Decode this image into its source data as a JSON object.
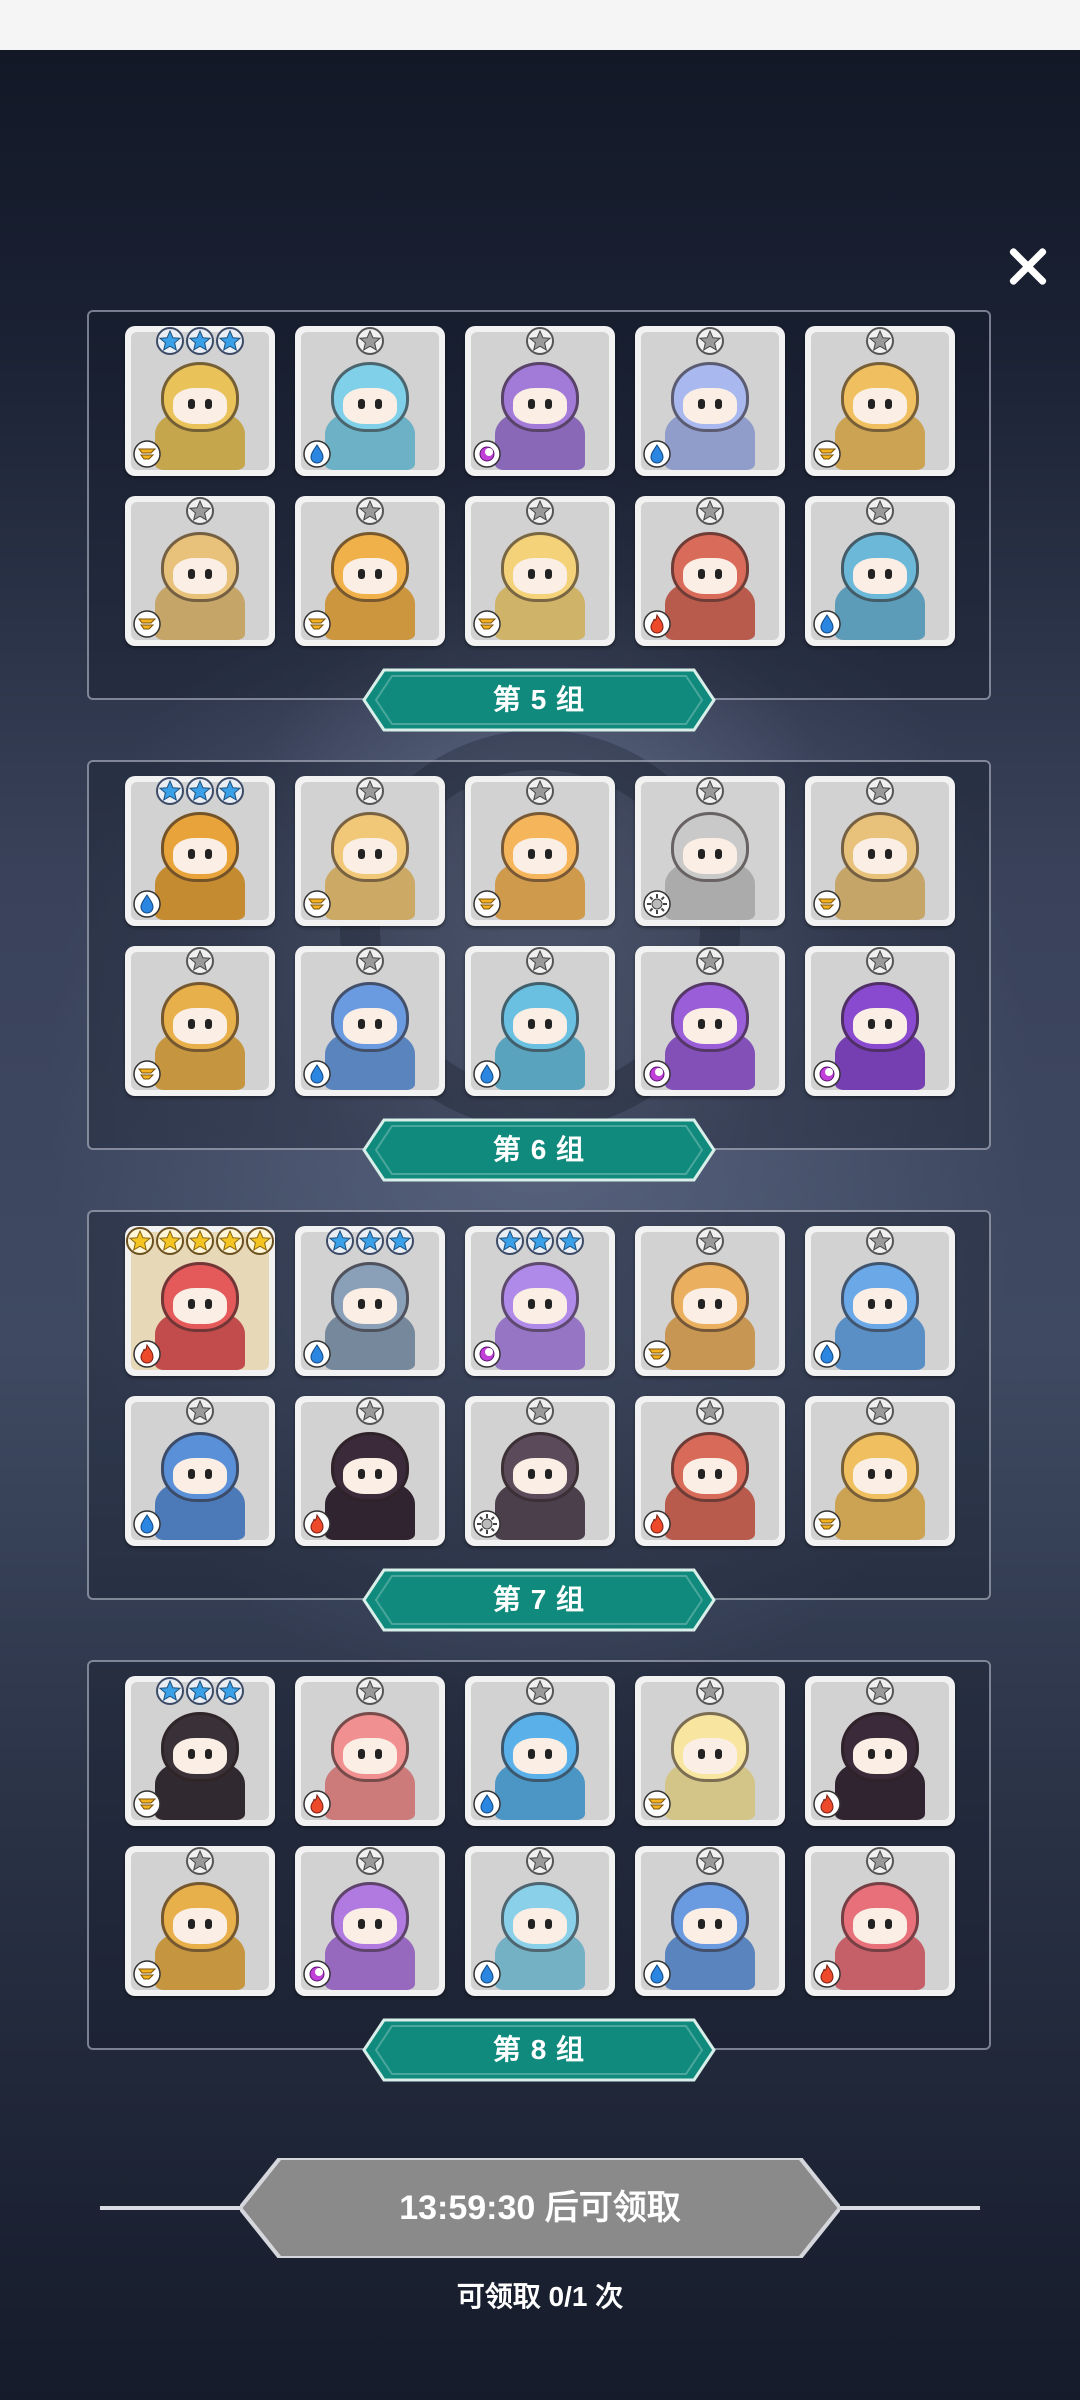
{
  "close_icon": "close-x-icon",
  "groups": [
    {
      "label": "第 5 组",
      "heroes": [
        {
          "name": "clock-golem",
          "stars": 3,
          "element": "thunder",
          "color": "#e9c35a"
        },
        {
          "name": "bandaged-mummy",
          "stars": 1,
          "element": "water",
          "color": "#7fd0e8"
        },
        {
          "name": "purple-cactus",
          "stars": 1,
          "element": "dark",
          "color": "#a27ad8"
        },
        {
          "name": "blue-ghost",
          "stars": 1,
          "element": "water",
          "color": "#a9b9ef"
        },
        {
          "name": "knight-cat",
          "stars": 1,
          "element": "thunder",
          "color": "#f0c060"
        },
        {
          "name": "moai-statue",
          "stars": 1,
          "element": "thunder",
          "color": "#e8c27a"
        },
        {
          "name": "pyramid-head",
          "stars": 1,
          "element": "thunder",
          "color": "#f0b04a"
        },
        {
          "name": "winged-knight",
          "stars": 1,
          "element": "thunder",
          "color": "#f3d27a"
        },
        {
          "name": "red-giraffe",
          "stars": 1,
          "element": "fire",
          "color": "#d96b5b"
        },
        {
          "name": "blue-chest-mimic",
          "stars": 1,
          "element": "water",
          "color": "#6cb8d8"
        }
      ]
    },
    {
      "label": "第 6 组",
      "heroes": [
        {
          "name": "crowned-queen",
          "stars": 3,
          "element": "water",
          "color": "#e8a43a"
        },
        {
          "name": "bandaged-mummy-yellow",
          "stars": 1,
          "element": "thunder",
          "color": "#f0c878"
        },
        {
          "name": "bow-girl",
          "stars": 1,
          "element": "thunder",
          "color": "#f5b55a"
        },
        {
          "name": "helmet-cat",
          "stars": 1,
          "element": "light",
          "color": "#c9c9c9"
        },
        {
          "name": "moai-statue",
          "stars": 1,
          "element": "thunder",
          "color": "#e8c27a"
        },
        {
          "name": "scholar-gold",
          "stars": 1,
          "element": "thunder",
          "color": "#e8b04a"
        },
        {
          "name": "scholar-blue",
          "stars": 1,
          "element": "water",
          "color": "#6a9be0"
        },
        {
          "name": "ice-beast",
          "stars": 1,
          "element": "water",
          "color": "#6ac0e0"
        },
        {
          "name": "purple-giraffe",
          "stars": 1,
          "element": "dark",
          "color": "#9a5ed8"
        },
        {
          "name": "purple-reaper",
          "stars": 1,
          "element": "dark",
          "color": "#8a4ad0"
        }
      ]
    },
    {
      "label": "第 7 组",
      "heroes": [
        {
          "name": "fox-girl",
          "stars": 5,
          "element": "fire",
          "color": "#e45a5a",
          "gold": true
        },
        {
          "name": "iron-knight",
          "stars": 3,
          "element": "water",
          "color": "#8aa0b8"
        },
        {
          "name": "purple-princess",
          "stars": 3,
          "element": "dark",
          "color": "#b08ae8"
        },
        {
          "name": "lion-beast",
          "stars": 1,
          "element": "thunder",
          "color": "#eab060"
        },
        {
          "name": "polka-mushroom",
          "stars": 1,
          "element": "water",
          "color": "#6aa8e8"
        },
        {
          "name": "goggle-wizard",
          "stars": 1,
          "element": "water",
          "color": "#5a90d8"
        },
        {
          "name": "shrine-maiden",
          "stars": 1,
          "element": "fire",
          "color": "#3a2a3a"
        },
        {
          "name": "white-witch",
          "stars": 1,
          "element": "light",
          "color": "#5a4a5a"
        },
        {
          "name": "red-knight",
          "stars": 1,
          "element": "fire",
          "color": "#d86a5a"
        },
        {
          "name": "blonde-paladin",
          "stars": 1,
          "element": "thunder",
          "color": "#f0c060"
        }
      ]
    },
    {
      "label": "第 8 组",
      "heroes": [
        {
          "name": "dark-idol",
          "stars": 3,
          "element": "thunder",
          "color": "#3a3038"
        },
        {
          "name": "bandaged-mummy-red",
          "stars": 1,
          "element": "fire",
          "color": "#f09090"
        },
        {
          "name": "blue-dino",
          "stars": 1,
          "element": "water",
          "color": "#5ab0e8"
        },
        {
          "name": "yellow-ghost",
          "stars": 1,
          "element": "thunder",
          "color": "#f8e6a0"
        },
        {
          "name": "shrine-maiden",
          "stars": 1,
          "element": "fire",
          "color": "#3a2a3a"
        },
        {
          "name": "yellow-witch",
          "stars": 1,
          "element": "thunder",
          "color": "#e8b04a"
        },
        {
          "name": "purple-moai",
          "stars": 1,
          "element": "dark",
          "color": "#b07ae0"
        },
        {
          "name": "flower-girl",
          "stars": 1,
          "element": "water",
          "color": "#8ad0e8"
        },
        {
          "name": "scholar-blue",
          "stars": 1,
          "element": "water",
          "color": "#6a9be0"
        },
        {
          "name": "red-demon",
          "stars": 1,
          "element": "fire",
          "color": "#e8707a"
        }
      ]
    }
  ],
  "claim": {
    "countdown_label": "13:59:30 后可领取",
    "claim_count": "可领取 0/1 次"
  },
  "colors": {
    "banner": "#0f8a7c",
    "claim_button": "#8a8a8a",
    "background": "#1b2236"
  }
}
